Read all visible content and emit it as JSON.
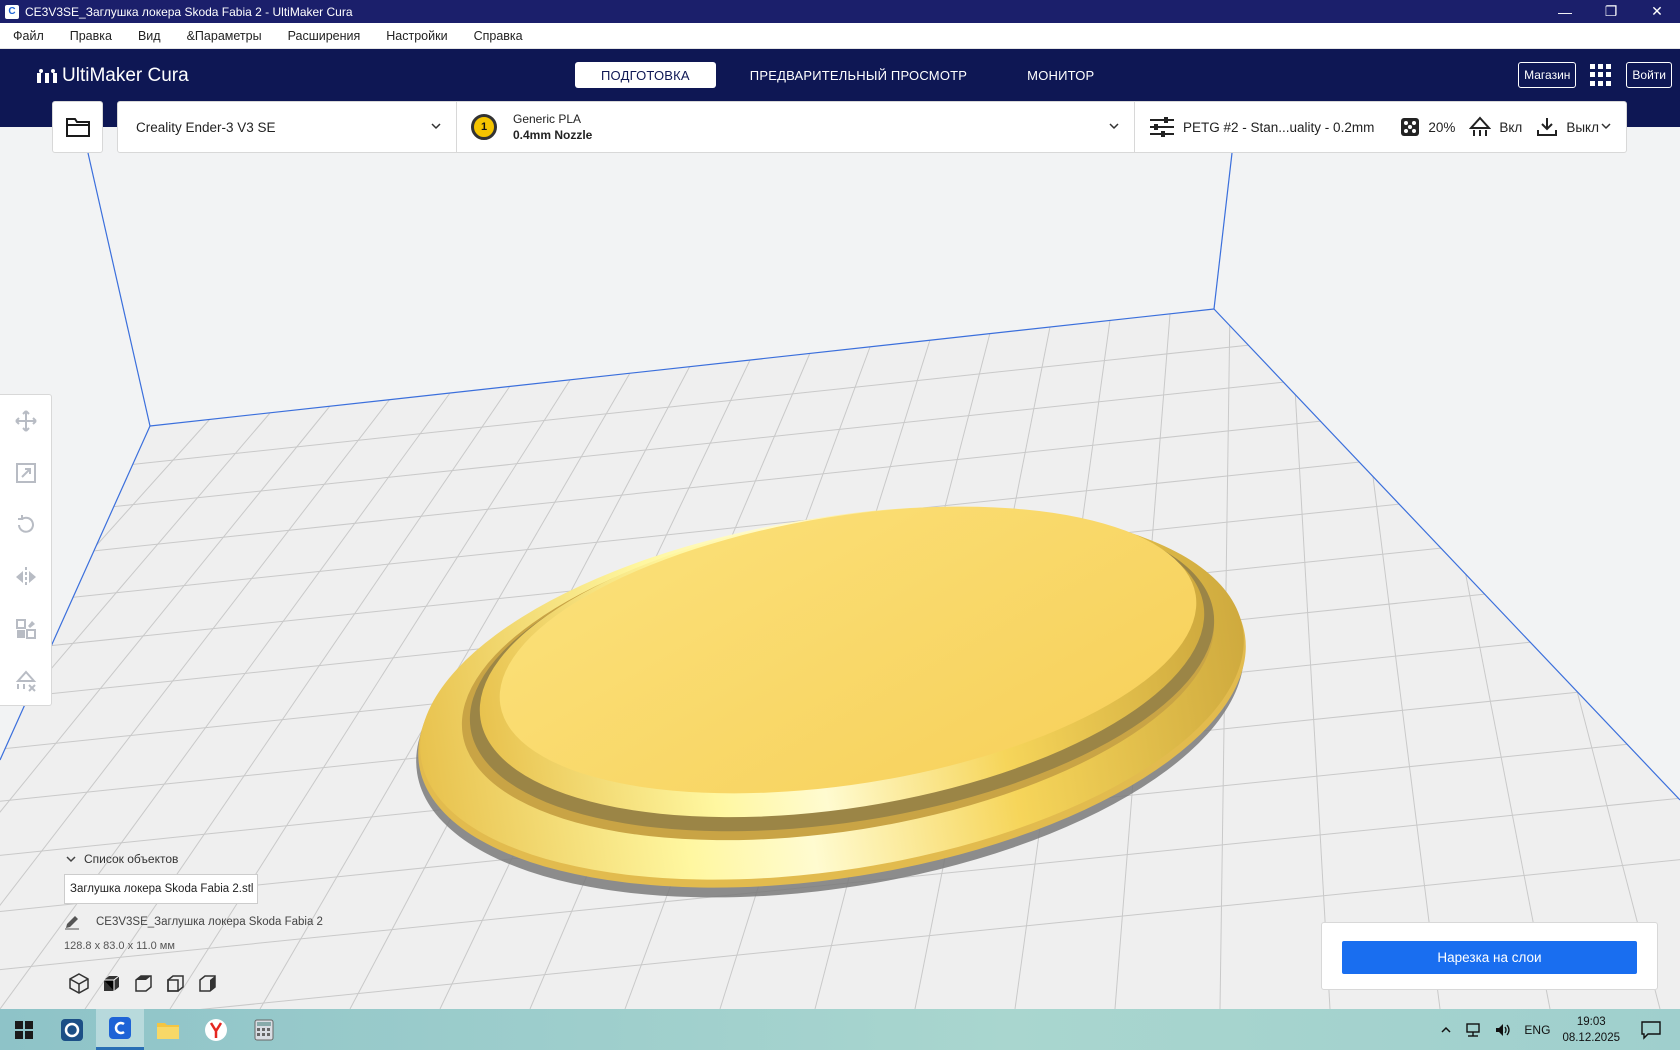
{
  "window": {
    "title": "CE3V3SE_Заглушка локера Skoda Fabia 2 - UltiMaker Cura",
    "minimize": "—",
    "restore": "❐",
    "close": "✕"
  },
  "menu": [
    "Файл",
    "Правка",
    "Вид",
    "&Параметры",
    "Расширения",
    "Настройки",
    "Справка"
  ],
  "header": {
    "logo": "UltiMaker Cura",
    "stages": [
      {
        "label": "ПОДГОТОВКА",
        "active": true
      },
      {
        "label": "ПРЕДВАРИТЕЛЬНЫЙ ПРОСМОТР",
        "active": false
      },
      {
        "label": "МОНИТОР",
        "active": false
      }
    ],
    "marketplace": "Магазин",
    "signin": "Войти"
  },
  "printer": {
    "name": "Creality Ender-3 V3 SE"
  },
  "material": {
    "extruder": "1",
    "name": "Generic PLA",
    "nozzle": "0.4mm Nozzle"
  },
  "profile": {
    "name": "PETG #2 - Stan...uality - 0.2mm",
    "infill": "20%",
    "support": "Вкл",
    "adhesion": "Выкл"
  },
  "objects": {
    "header": "Список объектов",
    "file": "Заглушка локера Skoda Fabia 2.stl",
    "project": "CE3V3SE_Заглушка локера Skoda Fabia 2",
    "dimensions": "128.8 x 83.0 x 11.0 мм"
  },
  "slice": {
    "label": "Нарезка на слои"
  },
  "taskbar": {
    "lang": "ENG",
    "time": "19:03",
    "date": "08.12.2025"
  },
  "colors": {
    "header": "#0e1754",
    "accent": "#196ef0",
    "model": "#f9d65c"
  }
}
